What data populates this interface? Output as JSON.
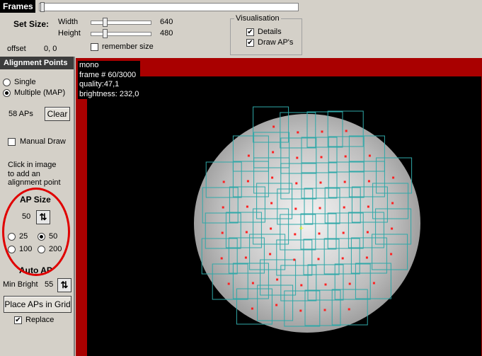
{
  "frames": {
    "label": "Frames"
  },
  "set_size": {
    "label": "Set Size:",
    "width_label": "Width",
    "width_value": "640",
    "height_label": "Height",
    "height_value": "480",
    "offset_label": "offset",
    "offset_value": "0, 0",
    "remember_label": "remember size"
  },
  "visualisation": {
    "title": "Visualisation",
    "details_label": "Details",
    "draw_aps_label": "Draw AP's"
  },
  "alignment": {
    "header": "Alignment Points",
    "single_label": "Single",
    "multiple_label": "Multiple (MAP)",
    "ap_count": "58 APs",
    "clear_label": "Clear",
    "manual_draw_label": "Manual Draw",
    "hint": [
      "Click in image",
      "to add an",
      "alignment point"
    ],
    "ap_size_title": "AP Size",
    "ap_size_value": "50",
    "size_25": "25",
    "size_50": "50",
    "size_100": "100",
    "size_200": "200",
    "auto_ap_title": "Auto AP",
    "min_bright_label": "Min Bright",
    "min_bright_value": "55",
    "place_grid_label": "Place APs in Grid",
    "replace_label": "Replace"
  },
  "image_info": {
    "line1": "mono",
    "line2": "frame # 60/3000",
    "line3": "quality:47,1",
    "line4": "brightness: 232,0"
  },
  "colors": {
    "ap_box": "#2fa8a8",
    "ap_point": "#ff2020",
    "image_border": "#a90000",
    "annotation_circle": "#e00000"
  }
}
